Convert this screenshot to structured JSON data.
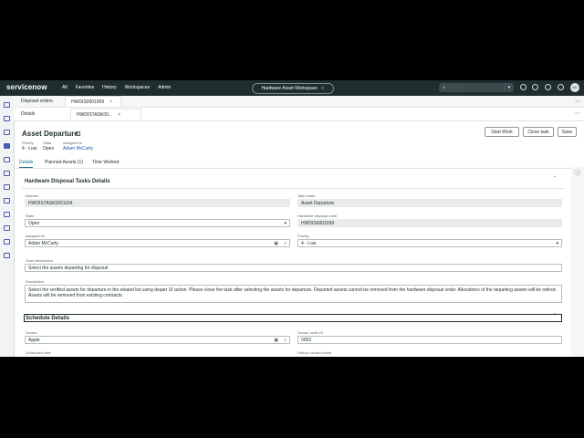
{
  "topnav": {
    "logo": "servicenow",
    "menu": [
      "All",
      "Favorites",
      "History",
      "Workspaces",
      "Admin"
    ],
    "workspace_title": "Hardware Asset Workspace",
    "search_label": "Search",
    "avatar_initials": "AD"
  },
  "tabs": {
    "row1": [
      {
        "label": "Disposal orders"
      },
      {
        "label": "HWDIS0001059"
      }
    ],
    "row2": [
      {
        "label": "Details"
      },
      {
        "label": "HWDISTASK00..."
      }
    ]
  },
  "record": {
    "title": "Asset Departure",
    "meta": [
      {
        "label": "Priority",
        "value": "4 - Low"
      },
      {
        "label": "State",
        "value": "Open"
      },
      {
        "label": "Assigned to",
        "value": "Adam McCarty"
      }
    ],
    "buttons": {
      "start": "Start Work",
      "close": "Close task",
      "save": "Save"
    },
    "subtabs": [
      "Details",
      "Planned Assets (1)",
      "Time Worked"
    ]
  },
  "form": {
    "section_title": "Hardware Disposal Tasks Details",
    "number_label": "Number",
    "number_value": "HWDISTASK0001164",
    "task_name_label": "Task name",
    "task_name_value": "Asset Departure",
    "state_label": "State",
    "state_value": "Open",
    "disposal_order_label": "Hardware disposal order",
    "disposal_order_value": "HWDIS0001059",
    "assigned_label": "Assigned to",
    "assigned_value": "Adam McCarty",
    "priority_label": "Priority",
    "priority_value": "4 - Low",
    "short_desc_label": "Short description",
    "short_desc_value": "Select the assets departing for disposal",
    "description_label": "Description",
    "description_value": "Select the verified assets for departure in the related list using depart UI action. Please close the task after selecting the assets for departure. Departed assets cannot be removed from the hardware disposal order.  Allocations of the departing assets will be retired. Assets will be removed from existing contracts.",
    "schedule_title": "Schedule Details",
    "vendor_label": "Vendor",
    "vendor_value": "Apple",
    "vendor_order_label": "Vendor order ID",
    "vendor_order_value": "0002",
    "scheduled_date_label": "Scheduled date",
    "pickup_contact_label": "Pickup contact name"
  }
}
